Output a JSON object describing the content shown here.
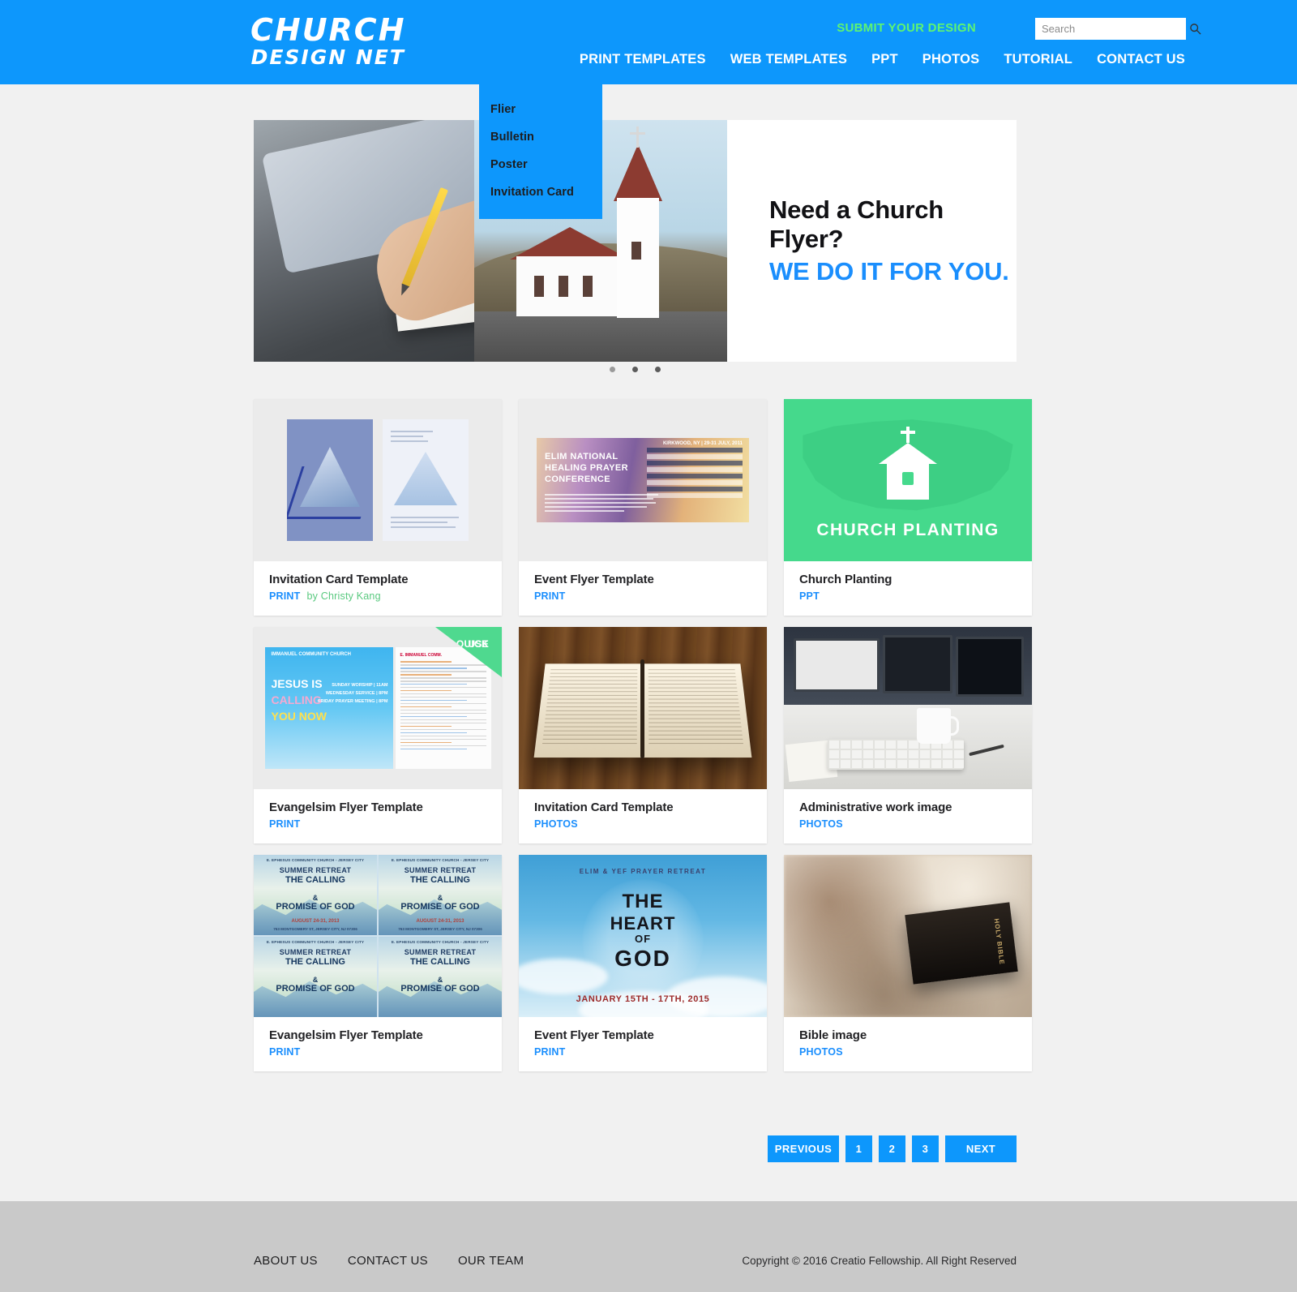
{
  "site": {
    "logo_line1": "CHURCH",
    "logo_line2": "DESIGN NET"
  },
  "header": {
    "submit_link": "SUBMIT YOUR DESIGN",
    "search_placeholder": "Search",
    "search_value": "",
    "search_icon": "search-icon",
    "nav": [
      {
        "label": "PRINT TEMPLATES"
      },
      {
        "label": "WEB TEMPLATES"
      },
      {
        "label": "PPT"
      },
      {
        "label": "PHOTOS"
      },
      {
        "label": "TUTORIAL"
      },
      {
        "label": "CONTACT US"
      }
    ],
    "dropdown": {
      "parent": "PRINT TEMPLATES",
      "items": [
        {
          "label": "Flier"
        },
        {
          "label": "Bulletin"
        },
        {
          "label": "Poster"
        },
        {
          "label": "Invitation Card"
        }
      ]
    }
  },
  "hero": {
    "headline": "Need a Church Flyer?",
    "subheadline": "WE DO IT FOR YOU.",
    "slides": 3,
    "active_slide": 1
  },
  "cards": [
    {
      "title": "Invitation Card Template",
      "category": "PRINT",
      "author": "by Christy Kang",
      "badge": ""
    },
    {
      "title": "Event Flyer Template",
      "category": "PRINT",
      "author": "",
      "badge": ""
    },
    {
      "title": "Church Planting",
      "category": "PPT",
      "author": "",
      "badge": ""
    },
    {
      "title": "Evangelsim Flyer Template",
      "category": "PRINT",
      "author": "",
      "badge": "QUICK USE"
    },
    {
      "title": "Invitation Card Template",
      "category": "PHOTOS",
      "author": "",
      "badge": ""
    },
    {
      "title": "Administrative work image",
      "category": "PHOTOS",
      "author": "",
      "badge": ""
    },
    {
      "title": "Evangelsim Flyer Template",
      "category": "PRINT",
      "author": "",
      "badge": ""
    },
    {
      "title": "Event Flyer Template",
      "category": "PRINT",
      "author": "",
      "badge": ""
    },
    {
      "title": "Bible image",
      "category": "PHOTOS",
      "author": "",
      "badge": ""
    }
  ],
  "thumbnails": {
    "card3_label": "CHURCH PLANTING",
    "card2_title": "ELIM NATIONAL\nHEALING PRAYER\nCONFERENCE",
    "card2_location": "KIRKWOOD, NY | 29-31 JULY, 2011",
    "card4_church": "IMMANUEL COMMUNITY CHURCH",
    "card4_line1": "JESUS IS",
    "card4_line2": "CALLING",
    "card4_line3": "YOU NOW",
    "card4_badge_line1": "QUICK",
    "card4_badge_line2": "USE",
    "card7_header": "E. EPHESUS COMMUNITY CHURCH - JERSEY CITY",
    "card7_sub": "SUMMER RETREAT",
    "card7_line1": "THE CALLING",
    "card7_amp": "&",
    "card7_line2": "PROMISE OF GOD",
    "card7_date": "AUGUST 24-31, 2013",
    "card7_addr": "763 MONTGOMERY ST, JERSEY CITY, NJ 07306",
    "card8_header": "ELIM & YEF PRAYER RETREAT",
    "card8_w1": "THE",
    "card8_w2": "HEART",
    "card8_w3": "OF",
    "card8_w4": "GOD",
    "card8_date": "JANUARY 15TH - 17TH, 2015",
    "card9_spine": "HOLY BIBLE"
  },
  "pagination": {
    "previous": "PREVIOUS",
    "pages": [
      "1",
      "2",
      "3"
    ],
    "next": "NEXT",
    "current": "1"
  },
  "footer": {
    "links": [
      {
        "label": "ABOUT US"
      },
      {
        "label": "CONTACT US"
      },
      {
        "label": "OUR TEAM"
      }
    ],
    "copyright": "Copyright © 2016 Creatio Fellowship. All Right Reserved"
  },
  "colors": {
    "brand_blue": "#0d97fc",
    "accent_green": "#5ef472",
    "author_green": "#59c97f",
    "page_bg": "#f1f1f1",
    "footer_bg": "#c9c9c9"
  }
}
